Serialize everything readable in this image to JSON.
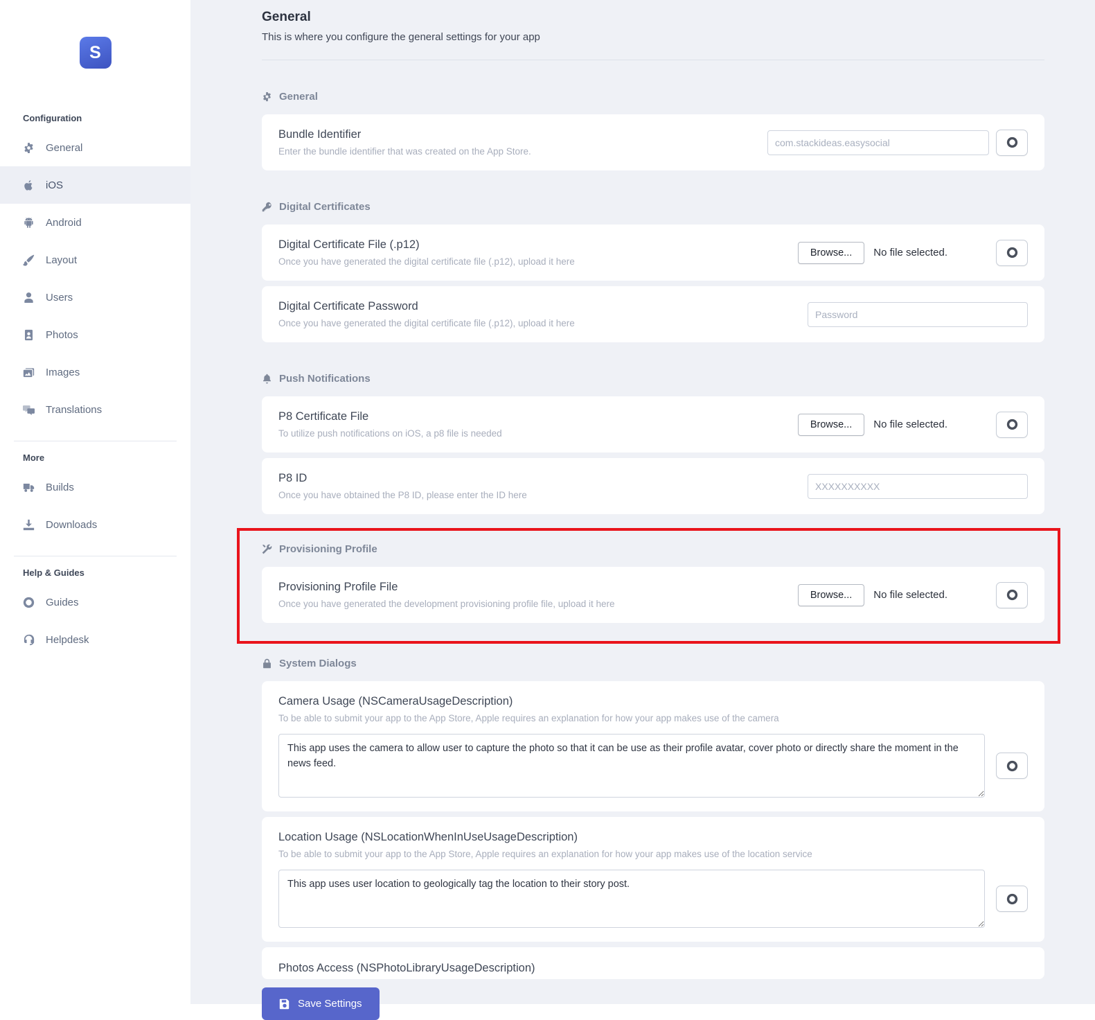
{
  "logo_letter": "S",
  "sidebar": {
    "sections": [
      {
        "header": "Configuration",
        "items": [
          {
            "label": "General"
          },
          {
            "label": "iOS"
          },
          {
            "label": "Android"
          },
          {
            "label": "Layout"
          },
          {
            "label": "Users"
          },
          {
            "label": "Photos"
          },
          {
            "label": "Images"
          },
          {
            "label": "Translations"
          }
        ]
      },
      {
        "header": "More",
        "items": [
          {
            "label": "Builds"
          },
          {
            "label": "Downloads"
          }
        ]
      },
      {
        "header": "Help & Guides",
        "items": [
          {
            "label": "Guides"
          },
          {
            "label": "Helpdesk"
          }
        ]
      }
    ]
  },
  "page": {
    "title": "General",
    "subtitle": "This is where you configure the general settings for your app"
  },
  "ui": {
    "browse": "Browse...",
    "no_file": "No file selected."
  },
  "sections": {
    "general": {
      "title": "General",
      "bundle": {
        "label": "Bundle Identifier",
        "description": "Enter the bundle identifier that was created on the App Store.",
        "placeholder": "com.stackideas.easysocial"
      }
    },
    "certificates": {
      "title": "Digital Certificates",
      "file": {
        "label": "Digital Certificate File (.p12)",
        "description": "Once you have generated the digital certificate file (.p12), upload it here"
      },
      "password": {
        "label": "Digital Certificate Password",
        "description": "Once you have generated the digital certificate file (.p12), upload it here",
        "placeholder": "Password"
      }
    },
    "push": {
      "title": "Push Notifications",
      "file": {
        "label": "P8 Certificate File",
        "description": "To utilize push notifications on iOS, a p8 file is needed"
      },
      "p8id": {
        "label": "P8 ID",
        "description": "Once you have obtained the P8 ID, please enter the ID here",
        "placeholder": "XXXXXXXXXX"
      }
    },
    "provisioning": {
      "title": "Provisioning Profile",
      "file": {
        "label": "Provisioning Profile File",
        "description": "Once you have generated the development provisioning profile file, upload it here"
      }
    },
    "dialogs": {
      "title": "System Dialogs",
      "camera": {
        "label": "Camera Usage (NSCameraUsageDescription)",
        "description": "To be able to submit your app to the App Store, Apple requires an explanation for how your app makes use of the camera",
        "value": "This app uses the camera to allow user to capture the photo so that it can be use as their profile avatar, cover photo or directly share the moment in the news feed."
      },
      "location": {
        "label": "Location Usage (NSLocationWhenInUseUsageDescription)",
        "description": "To be able to submit your app to the App Store, Apple requires an explanation for how your app makes use of the location service",
        "value": "This app uses user location to geologically tag the location to their story post."
      },
      "photos": {
        "label": "Photos Access (NSPhotoLibraryUsageDescription)"
      }
    }
  },
  "footer": {
    "save_label": "Save Settings"
  },
  "colors": {
    "accent": "#5766cb",
    "highlight_border": "#e9141c",
    "main_bg": "#eff1f6"
  }
}
